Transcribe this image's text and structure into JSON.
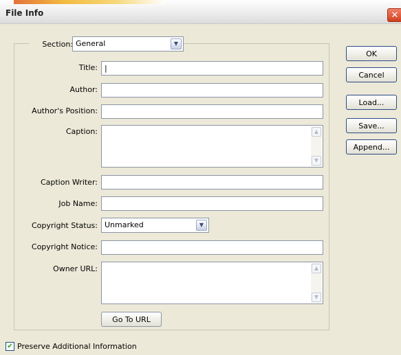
{
  "window": {
    "title": "File Info",
    "close_glyph": "✕"
  },
  "section": {
    "label": "Section:",
    "value": "General"
  },
  "fields": {
    "title": {
      "label": "Title:",
      "value": "|"
    },
    "author": {
      "label": "Author:",
      "value": ""
    },
    "authors_position": {
      "label": "Author's Position:",
      "value": ""
    },
    "caption": {
      "label": "Caption:",
      "value": ""
    },
    "caption_writer": {
      "label": "Caption Writer:",
      "value": ""
    },
    "job_name": {
      "label": "Job Name:",
      "value": ""
    },
    "copyright_status": {
      "label": "Copyright Status:",
      "value": "Unmarked"
    },
    "copyright_notice": {
      "label": "Copyright Notice:",
      "value": ""
    },
    "owner_url": {
      "label": "Owner URL:",
      "value": ""
    }
  },
  "buttons": {
    "go_to_url": "Go To URL",
    "ok": "OK",
    "cancel": "Cancel",
    "load": "Load...",
    "save": "Save...",
    "append": "Append..."
  },
  "preserve": {
    "label": "Preserve Additional Information",
    "checked": true,
    "check_glyph": "✔"
  },
  "icons": {
    "dropdown": "chevron-down-icon",
    "scroll_up": "scroll-up-icon",
    "scroll_down": "scroll-down-icon",
    "close": "close-icon",
    "check": "checkmark-icon"
  },
  "colors": {
    "window_bg": "#ece9d8",
    "close_button": "#d0401e",
    "button_border": "#2a4a85",
    "check": "#21a121"
  }
}
